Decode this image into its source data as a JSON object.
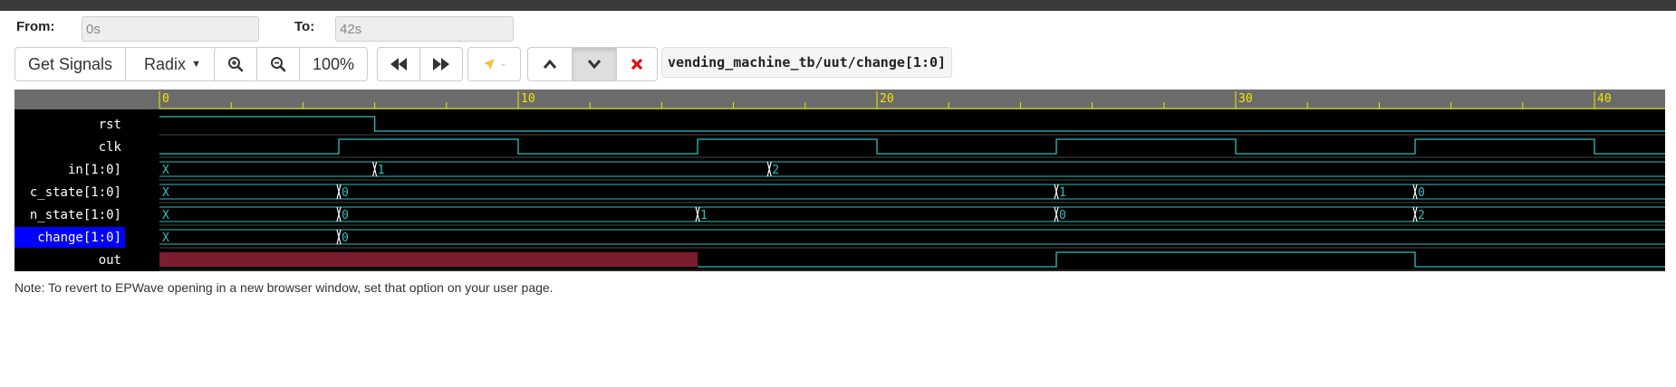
{
  "range": {
    "from_label": "From:",
    "from_value": "0s",
    "to_label": "To:",
    "to_value": "42s"
  },
  "toolbar": {
    "get_signals_label": "Get Signals",
    "radix_label": "Radix",
    "zoom_level": "100%",
    "marker_label": "-",
    "signal_path": "vending_machine_tb/uut/change[1:0]"
  },
  "waveform": {
    "time_end": 42,
    "ticks": [
      {
        "t": 0,
        "label": "0"
      },
      {
        "t": 10,
        "label": "10"
      },
      {
        "t": 20,
        "label": "20"
      },
      {
        "t": 30,
        "label": "30"
      },
      {
        "t": 40,
        "label": "40"
      }
    ],
    "selected_signal": "change[1:0]",
    "signals": [
      {
        "name": "rst",
        "type": "bit",
        "changes": [
          [
            0,
            1
          ],
          [
            6,
            0
          ]
        ]
      },
      {
        "name": "clk",
        "type": "bit",
        "changes": [
          [
            0,
            0
          ],
          [
            5,
            1
          ],
          [
            10,
            0
          ],
          [
            15,
            1
          ],
          [
            20,
            0
          ],
          [
            25,
            1
          ],
          [
            30,
            0
          ],
          [
            35,
            1
          ],
          [
            40,
            0
          ]
        ]
      },
      {
        "name": "in[1:0]",
        "type": "bus",
        "changes": [
          [
            0,
            "X"
          ],
          [
            6,
            "1"
          ],
          [
            17,
            "2"
          ]
        ]
      },
      {
        "name": "c_state[1:0]",
        "type": "bus",
        "changes": [
          [
            0,
            "X"
          ],
          [
            5,
            "0"
          ],
          [
            25,
            "1"
          ],
          [
            35,
            "0"
          ]
        ]
      },
      {
        "name": "n_state[1:0]",
        "type": "bus",
        "changes": [
          [
            0,
            "X"
          ],
          [
            5,
            "0"
          ],
          [
            15,
            "1"
          ],
          [
            25,
            "0"
          ],
          [
            35,
            "2"
          ]
        ]
      },
      {
        "name": "change[1:0]",
        "type": "bus",
        "changes": [
          [
            0,
            "X"
          ],
          [
            5,
            "0"
          ]
        ]
      },
      {
        "name": "out",
        "type": "bit",
        "changes": [
          [
            0,
            "x"
          ],
          [
            15,
            0
          ],
          [
            25,
            1
          ],
          [
            35,
            0
          ]
        ]
      }
    ],
    "colors": {
      "background": "#000000",
      "ruler": "#6b6b6b",
      "ruler_text": "#f0e600",
      "wave": "#2fc0c0",
      "high": "#35d07a",
      "unknown_fill": "#7a1e2e",
      "selected_bg": "#0000ff"
    }
  },
  "note": "Note: To revert to EPWave opening in a new browser window, set that option on your user page."
}
